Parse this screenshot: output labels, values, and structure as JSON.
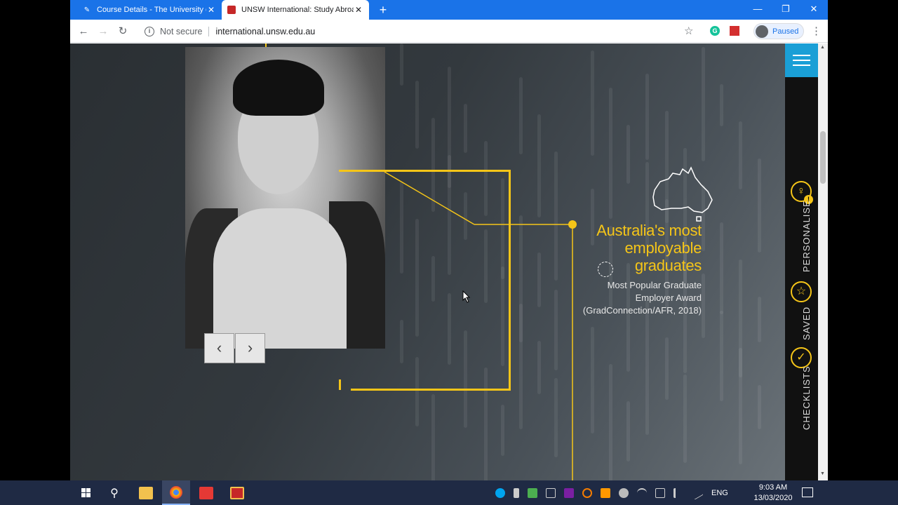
{
  "browser": {
    "tabs": [
      {
        "title": "Course Details - The University of"
      },
      {
        "title": "UNSW International: Study Abroad"
      }
    ],
    "address": {
      "security_label": "Not secure",
      "url": "international.unsw.edu.au"
    },
    "profile_label": "Paused"
  },
  "page": {
    "stat": {
      "title_lines": [
        "Australia's most",
        "employable",
        "graduates"
      ],
      "desc_lines": [
        "Most Popular Graduate",
        "Employer Award",
        "(GradConnection/AFR, 2018)"
      ]
    },
    "slider": {
      "prev_glyph": "‹",
      "next_glyph": "›"
    },
    "side_panel": {
      "items": [
        {
          "label": "PERSONALISE",
          "icon": "person-icon",
          "badge": "!"
        },
        {
          "label": "SAVED",
          "icon": "star-icon"
        },
        {
          "label": "CHECKLISTS",
          "icon": "check-icon"
        }
      ]
    },
    "accent_color": "#f5c518",
    "menu_color": "#1a9fd6"
  },
  "taskbar": {
    "language": "ENG",
    "time": "9:03 AM",
    "date": "13/03/2020"
  }
}
